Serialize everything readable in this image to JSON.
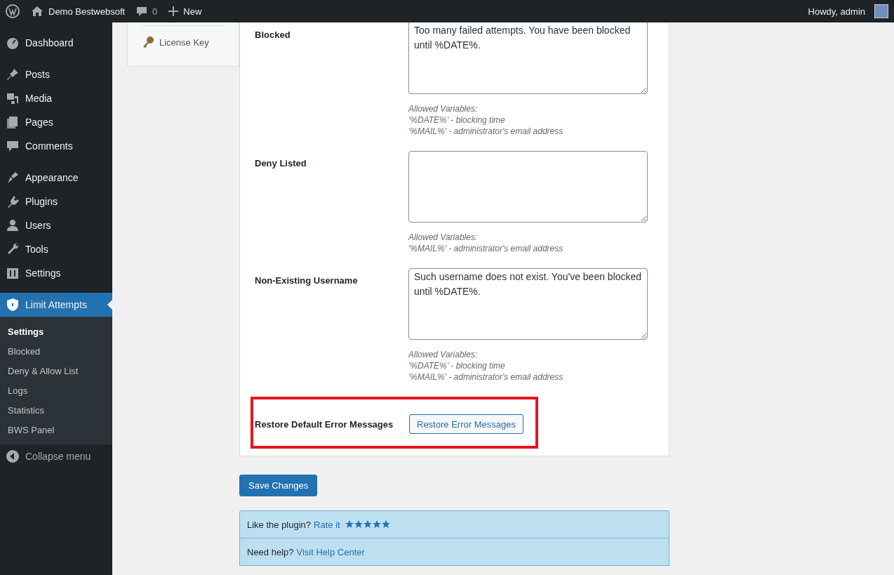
{
  "admin_bar": {
    "site": "Demo Bestwebsoft",
    "comments": "0",
    "new": "New",
    "greeting": "Howdy, admin"
  },
  "sidebar": {
    "groups": [
      [
        {
          "label": "Dashboard",
          "selected": false
        }
      ],
      [
        {
          "label": "Posts",
          "selected": false
        },
        {
          "label": "Media",
          "selected": false
        },
        {
          "label": "Pages",
          "selected": false
        },
        {
          "label": "Comments",
          "selected": false
        }
      ],
      [
        {
          "label": "Appearance",
          "selected": false
        },
        {
          "label": "Plugins",
          "selected": false
        },
        {
          "label": "Users",
          "selected": false
        },
        {
          "label": "Tools",
          "selected": false
        },
        {
          "label": "Settings",
          "selected": false
        }
      ],
      [
        {
          "label": "Limit Attempts",
          "selected": true,
          "children": [
            {
              "label": "Settings",
              "selected": true
            },
            {
              "label": "Blocked",
              "selected": false
            },
            {
              "label": "Deny & Allow List",
              "selected": false
            },
            {
              "label": "Logs",
              "selected": false
            },
            {
              "label": "Statistics",
              "selected": false
            },
            {
              "label": "BWS Panel",
              "selected": false
            }
          ]
        }
      ]
    ],
    "collapse": "Collapse menu"
  },
  "tabs_panel": {
    "items": [
      {
        "label": "License Key",
        "selected": false
      }
    ]
  },
  "settings": {
    "fields": [
      {
        "label": "Blocked",
        "value": "Too many failed attempts. You have been blocked until %DATE%.",
        "hints": [
          "Allowed Variables:",
          "'%DATE%' - blocking time",
          "'%MAIL%' - administrator's email address"
        ]
      },
      {
        "label": "Deny Listed",
        "hints": [
          "Allowed Variables:",
          "'%MAIL%' - administrator's email address"
        ]
      },
      {
        "label": "Non-Existing Username",
        "value": "Such username does not exist. You've been blocked until %DATE%.",
        "hints": [
          "Allowed Variables:",
          "'%DATE%' - blocking time",
          "'%MAIL%' - administrator's email address"
        ]
      }
    ],
    "restore": {
      "label": "Restore Default Error Messages",
      "button": "Restore Error Messages"
    }
  },
  "save_button": "Save Changes",
  "footer": {
    "rows": [
      {
        "text": "Like the plugin?",
        "link": "Rate it",
        "stars": 5
      },
      {
        "text": "Need help?",
        "link": "Visit Help Center"
      }
    ]
  }
}
